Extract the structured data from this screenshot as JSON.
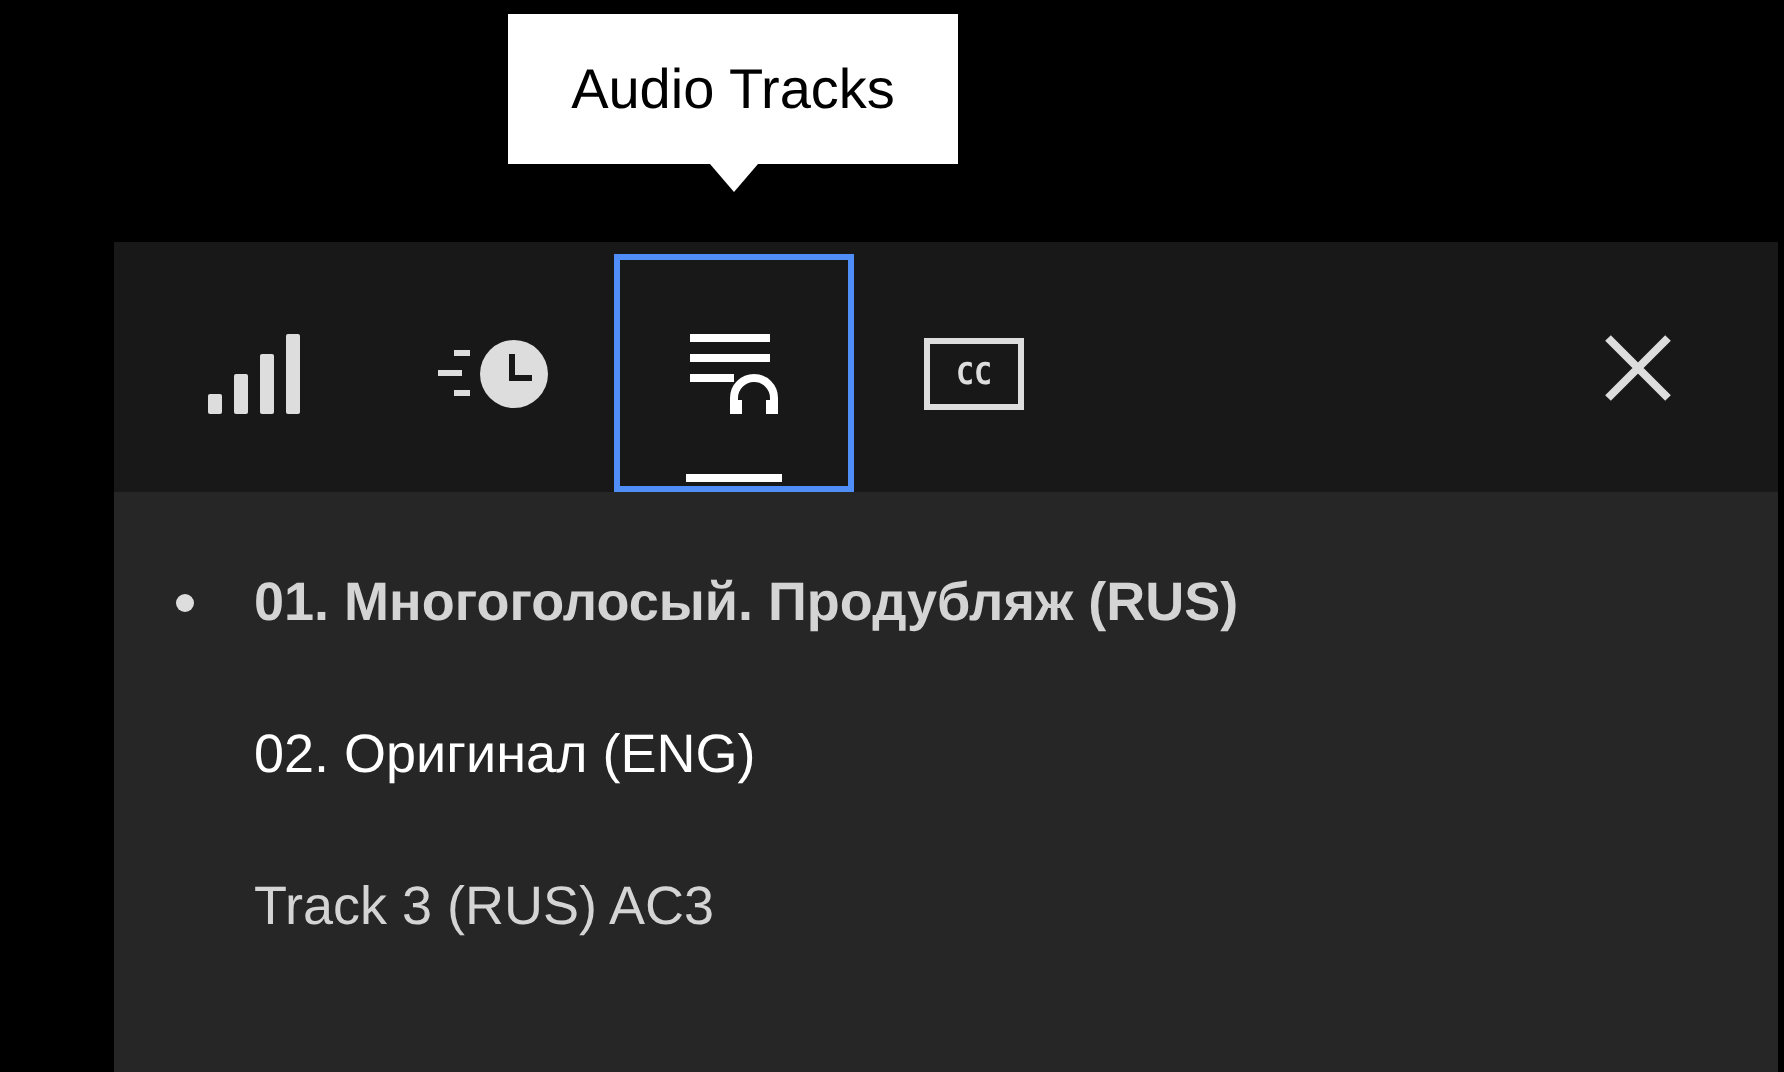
{
  "tooltip": {
    "text": "Audio Tracks"
  },
  "tabs": [
    {
      "kind": "signal",
      "selected": false
    },
    {
      "kind": "speed",
      "selected": false
    },
    {
      "kind": "audio",
      "selected": true
    },
    {
      "kind": "subtitles",
      "selected": false,
      "label": "CC"
    }
  ],
  "tracks": [
    {
      "label": "01. Многоголосый. Продубляж (RUS)",
      "selected": true,
      "highlighted": false
    },
    {
      "label": "02. Оригинал (ENG)",
      "selected": false,
      "highlighted": true
    },
    {
      "label": "Track 3 (RUS) AC3",
      "selected": false,
      "highlighted": false
    }
  ]
}
